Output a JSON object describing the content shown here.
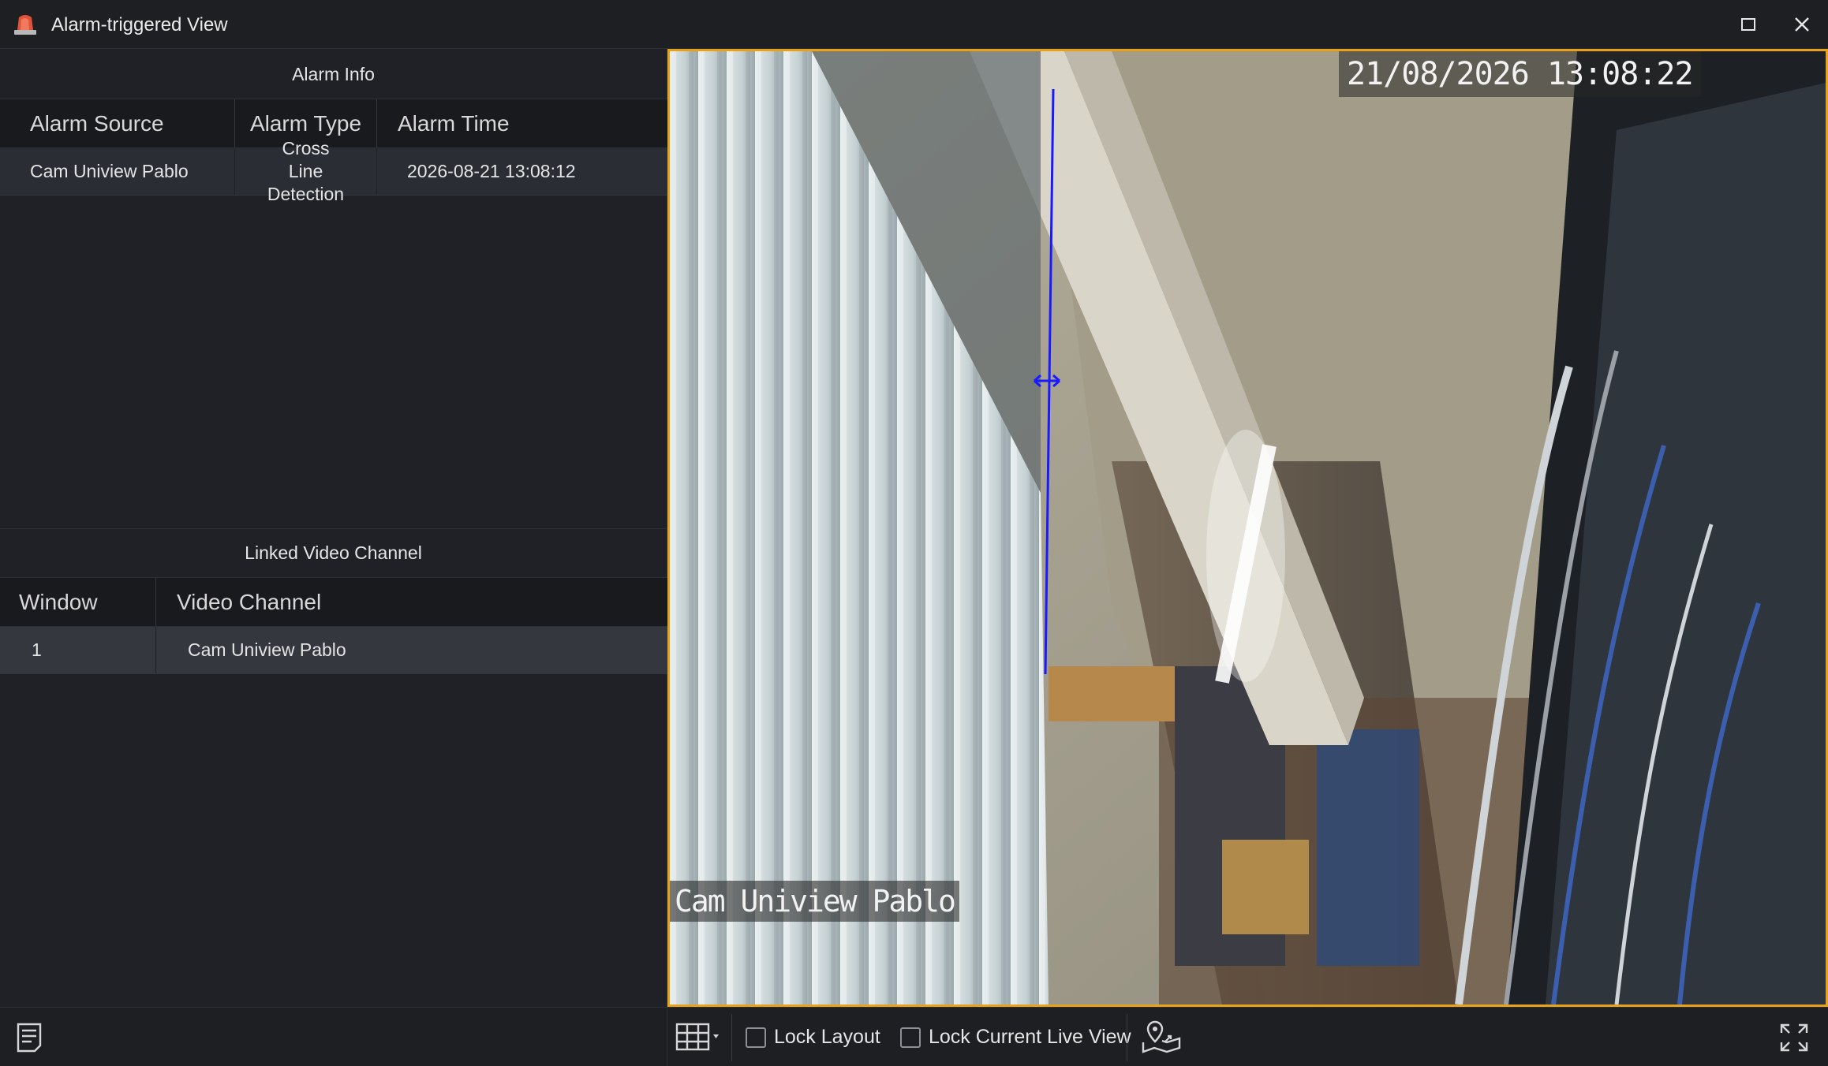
{
  "window": {
    "title": "Alarm-triggered View",
    "icon": "alarm-siren-icon"
  },
  "alarm_info": {
    "title": "Alarm Info",
    "columns": [
      "Alarm Source",
      "Alarm Type",
      "Alarm Time"
    ],
    "rows": [
      {
        "source": "Cam Uniview Pablo",
        "type": "Cross Line Detection",
        "time": "2026-08-21 13:08:12"
      }
    ]
  },
  "linked_video": {
    "title": "Linked Video Channel",
    "columns": [
      "Window",
      "Video Channel"
    ],
    "rows": [
      {
        "window": "1",
        "channel": "Cam Uniview Pablo"
      }
    ]
  },
  "video": {
    "osd_time": "21/08/2026 13:08:22",
    "osd_camera": "Cam Uniview Pablo",
    "border_color": "#e8a21a",
    "line_color": "#1a1aff"
  },
  "toolbar": {
    "lock_layout": "Lock Layout",
    "lock_current_live_view": "Lock Current Live View",
    "lock_layout_checked": false,
    "lock_live_view_checked": false
  }
}
